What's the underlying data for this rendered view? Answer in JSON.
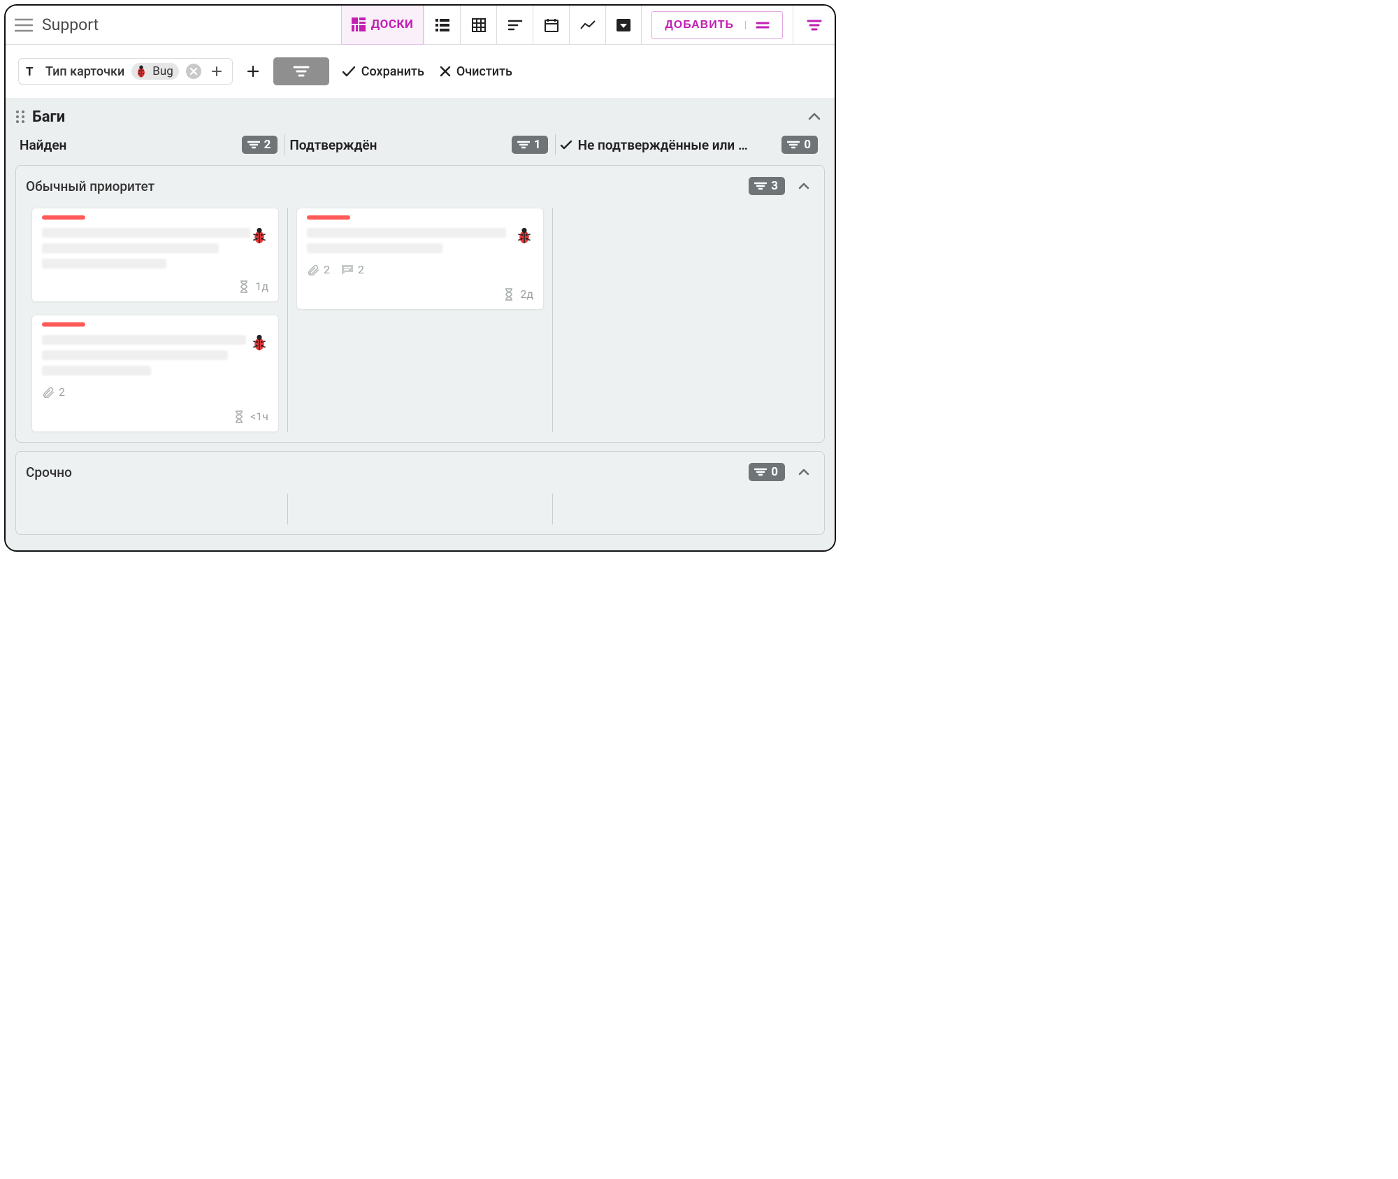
{
  "header": {
    "title": "Support",
    "active_view_label": "ДОСКИ",
    "add_label": "ДОБАВИТЬ"
  },
  "filter": {
    "chip_label": "Тип карточки",
    "chip_value": "Bug",
    "save_label": "Сохранить",
    "clear_label": "Очистить"
  },
  "group": {
    "title": "Баги",
    "columns": [
      {
        "name": "Найден",
        "count": "2"
      },
      {
        "name": "Подтверждён",
        "count": "1"
      },
      {
        "name": "Не подтверждённые или …",
        "count": "0",
        "check": true
      }
    ],
    "swimlanes": [
      {
        "title": "Обычный приоритет",
        "count": "3",
        "cols": [
          {
            "cards": [
              {
                "lines": [
                  92,
                  78,
                  55
                ],
                "time": "1д"
              },
              {
                "lines": [
                  90,
                  82,
                  48
                ],
                "attachments": "2",
                "time": "<1ч"
              }
            ]
          },
          {
            "cards": [
              {
                "lines": [
                  88,
                  60
                ],
                "attachments": "2",
                "comments": "2",
                "time": "2д"
              }
            ]
          },
          {
            "cards": []
          }
        ]
      },
      {
        "title": "Срочно",
        "count": "0",
        "cols": [
          {
            "cards": []
          },
          {
            "cards": []
          },
          {
            "cards": []
          }
        ]
      }
    ]
  }
}
